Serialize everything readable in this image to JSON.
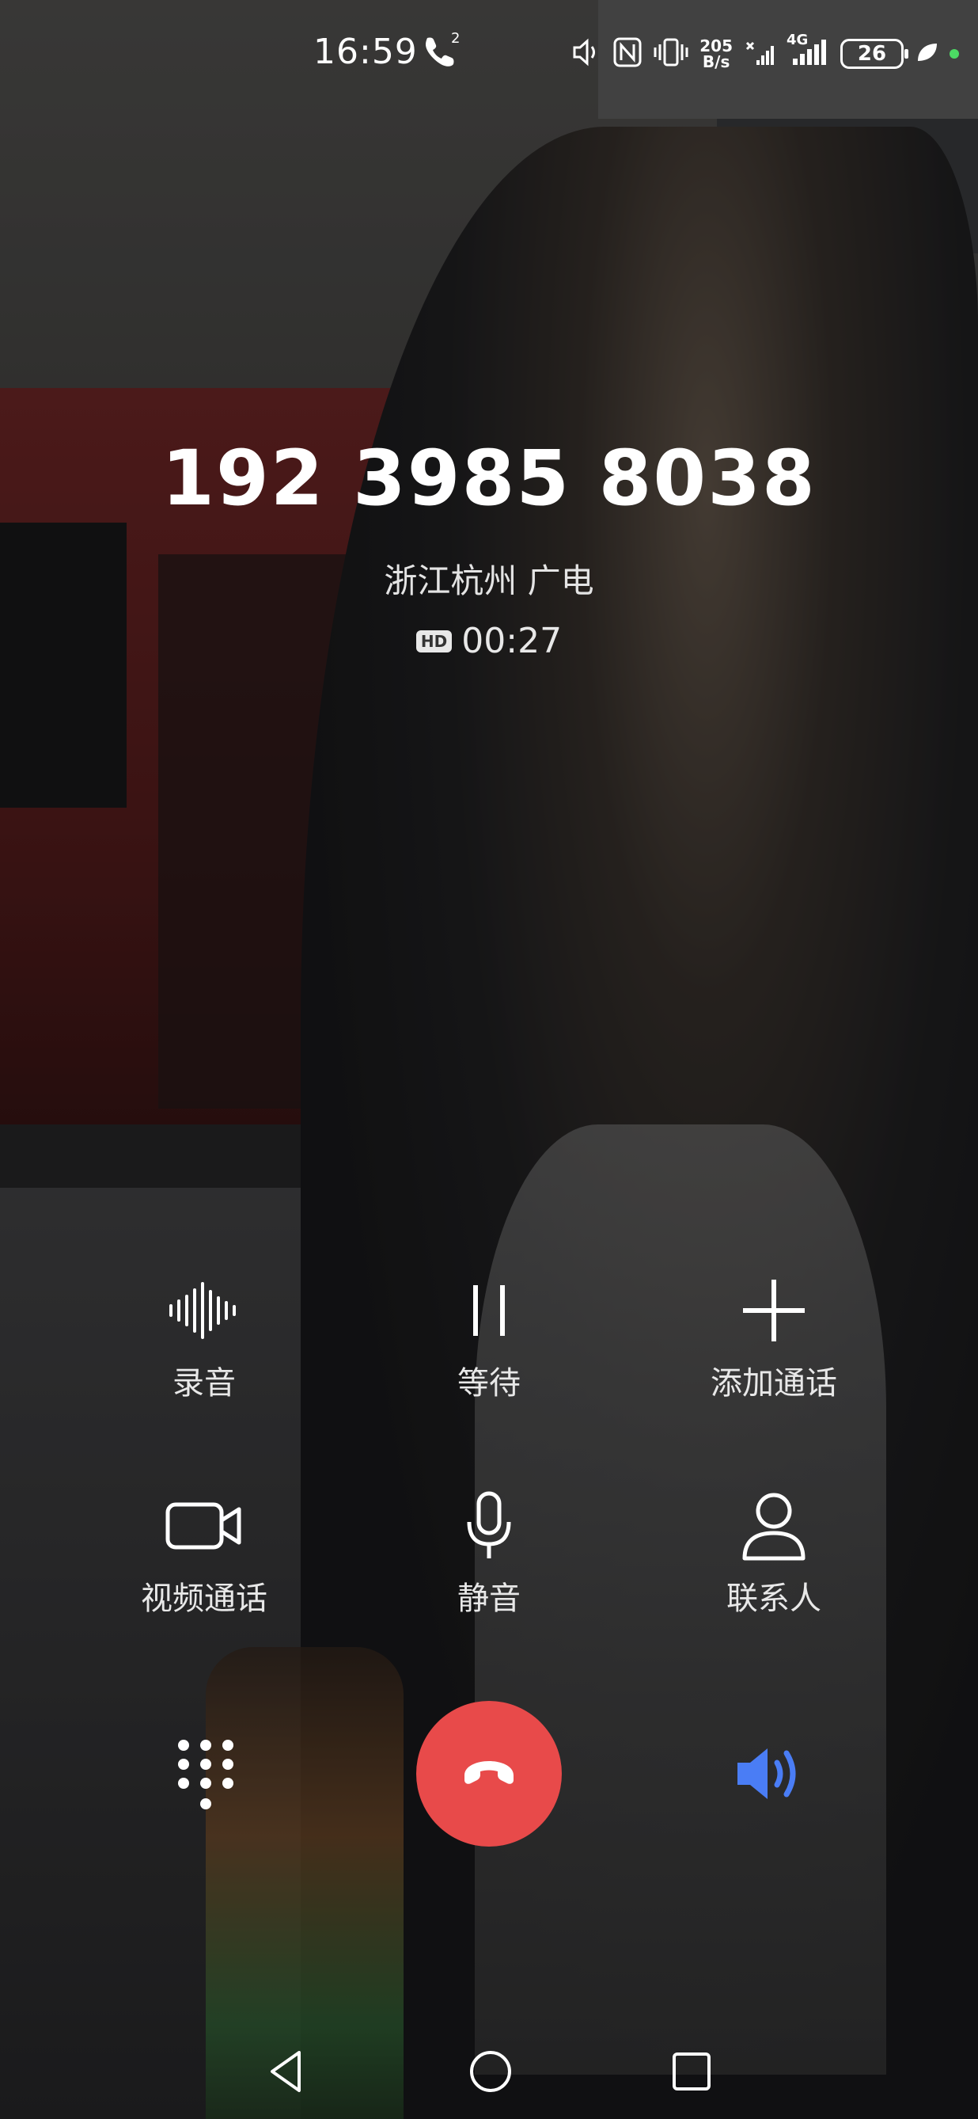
{
  "status_bar": {
    "time": "16:59",
    "call_badge": "2",
    "net_speed_value": "205",
    "net_speed_unit": "B/s",
    "network": "4G",
    "battery": "26"
  },
  "caller": {
    "number": "192 3985 8038",
    "location": "浙江杭州 广电",
    "hd_badge": "HD",
    "duration": "00:27"
  },
  "controls": [
    {
      "label": "录音",
      "icon": "record-waveform-icon"
    },
    {
      "label": "等待",
      "icon": "pause-icon"
    },
    {
      "label": "添加通话",
      "icon": "add-icon"
    },
    {
      "label": "视频通话",
      "icon": "video-camera-icon"
    },
    {
      "label": "静音",
      "icon": "microphone-icon"
    },
    {
      "label": "联系人",
      "icon": "contact-person-icon"
    }
  ],
  "colors": {
    "hangup": "#e84a4a",
    "speaker_active": "#4a7df5"
  }
}
